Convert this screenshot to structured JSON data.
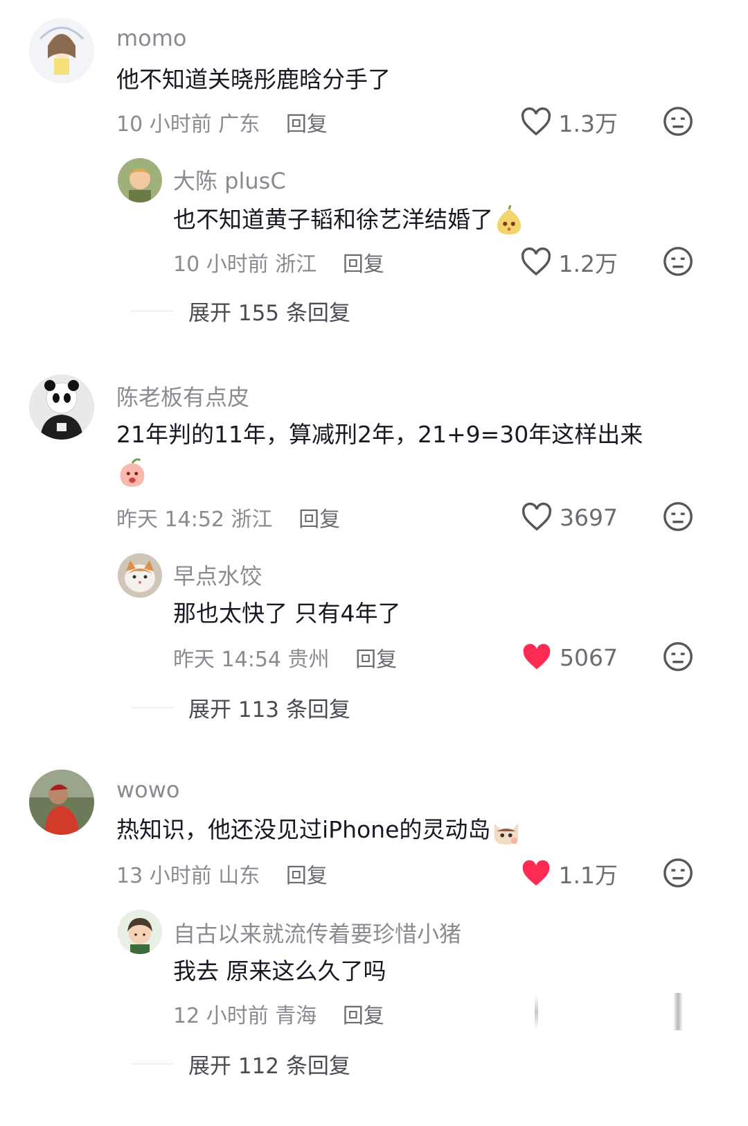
{
  "comments": [
    {
      "username": "momo",
      "text": "他不知道关晓彤鹿晗分手了",
      "time": "10 小时前",
      "location": "广东",
      "reply_label": "回复",
      "likes": "1.3万",
      "liked": false,
      "reply": {
        "username": "大陈 plusC",
        "text": "也不知道黄子韬和徐艺洋结婚了",
        "time": "10 小时前",
        "location": "浙江",
        "reply_label": "回复",
        "likes": "1.2万",
        "liked": false
      },
      "expand": "展开 155 条回复"
    },
    {
      "username": "陈老板有点皮",
      "text": "21年判的11年，算减刑2年，21+9=30年这样出来",
      "time": "昨天 14:52",
      "location": "浙江",
      "reply_label": "回复",
      "likes": "3697",
      "liked": false,
      "reply": {
        "username": "早点水饺",
        "text": "那也太快了 只有4年了",
        "time": "昨天 14:54",
        "location": "贵州",
        "reply_label": "回复",
        "likes": "5067",
        "liked": true
      },
      "expand": "展开 113 条回复"
    },
    {
      "username": "wowo",
      "text": "热知识，他还没见过iPhone的灵动岛",
      "time": "13 小时前",
      "location": "山东",
      "reply_label": "回复",
      "likes": "1.1万",
      "liked": true,
      "reply": {
        "username": "自古以来就流传着要珍惜小猪",
        "text": "我去 原来这么久了吗",
        "time": "12 小时前",
        "location": "青海",
        "reply_label": "回复"
      },
      "expand": "展开 112 条回复"
    }
  ],
  "colors": {
    "like_red": "#fe2c55",
    "gray_text": "#8a8b91"
  },
  "icons": [
    "heart-outline-icon",
    "heart-filled-icon",
    "dislike-face-icon"
  ]
}
